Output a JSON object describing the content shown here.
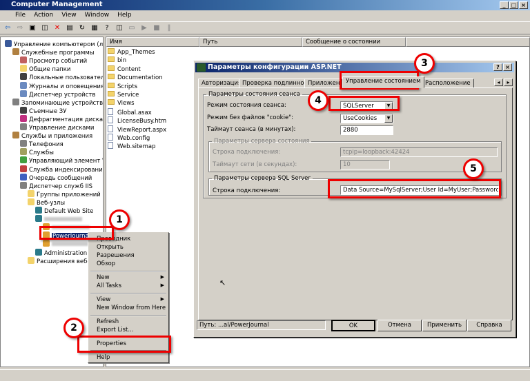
{
  "window": {
    "title": "Computer Management",
    "controls": [
      "_",
      "□",
      "×"
    ]
  },
  "menu": [
    "File",
    "Action",
    "View",
    "Window",
    "Help"
  ],
  "tree": [
    {
      "label": "Управление компьютером (локаль",
      "level": 0,
      "color": "#3a5a9a"
    },
    {
      "label": "Служебные программы",
      "level": 1,
      "color": "#b08040"
    },
    {
      "label": "Просмотр событий",
      "level": 2,
      "color": "#c06060"
    },
    {
      "label": "Общие папки",
      "level": 2,
      "color": "#f3d36b"
    },
    {
      "label": "Локальные пользователи",
      "level": 2,
      "color": "#404040"
    },
    {
      "label": "Журналы и оповещения пр",
      "level": 2,
      "color": "#6a8ac0"
    },
    {
      "label": "Диспетчер устройств",
      "level": 2,
      "color": "#6a8ac0"
    },
    {
      "label": "Запоминающие устройства",
      "level": 1,
      "color": "#808080"
    },
    {
      "label": "Съемные ЗУ",
      "level": 2,
      "color": "#404040"
    },
    {
      "label": "Дефрагментация диска",
      "level": 2,
      "color": "#c03080"
    },
    {
      "label": "Управление дисками",
      "level": 2,
      "color": "#808080"
    },
    {
      "label": "Службы и приложения",
      "level": 1,
      "color": "#b08040"
    },
    {
      "label": "Телефония",
      "level": 2,
      "color": "#808080"
    },
    {
      "label": "Службы",
      "level": 2,
      "color": "#a0a060"
    },
    {
      "label": "Управляющий элемент WM",
      "level": 2,
      "color": "#40a040"
    },
    {
      "label": "Служба индексирования",
      "level": 2,
      "color": "#c04040"
    },
    {
      "label": "Очередь сообщений",
      "level": 2,
      "color": "#4060c0"
    },
    {
      "label": "Диспетчер служб IIS",
      "level": 2,
      "color": "#808080"
    },
    {
      "label": "Группы приложений",
      "level": 3,
      "color": "#f3d36b"
    },
    {
      "label": "Веб-узлы",
      "level": 3,
      "color": "#f3d36b"
    },
    {
      "label": "Default Web Site",
      "level": 4,
      "color": "#2a7a8a"
    },
    {
      "label": "",
      "level": 4,
      "color": "#2a7a8a"
    },
    {
      "label": "",
      "level": 5,
      "color": "#e0a030"
    },
    {
      "label": "PowerJournal",
      "level": 5,
      "color": "#e0a030",
      "selected": true
    },
    {
      "label": "",
      "level": 5,
      "color": "#e0a030"
    },
    {
      "label": "Administration",
      "level": 4,
      "color": "#2a7a8a"
    },
    {
      "label": "Расширения веб-",
      "level": 3,
      "color": "#f3d36b"
    }
  ],
  "list": {
    "columns": [
      "Имя",
      "Путь",
      "Сообщение о состоянии"
    ],
    "items": [
      {
        "name": "App_Themes",
        "type": "folder"
      },
      {
        "name": "bin",
        "type": "folder"
      },
      {
        "name": "Content",
        "type": "folder"
      },
      {
        "name": "Documentation",
        "type": "folder"
      },
      {
        "name": "Scripts",
        "type": "folder"
      },
      {
        "name": "Service",
        "type": "folder"
      },
      {
        "name": "Views",
        "type": "folder"
      },
      {
        "name": "Global.asax",
        "type": "file"
      },
      {
        "name": "LicenseBusy.htm",
        "type": "file"
      },
      {
        "name": "ViewReport.aspx",
        "type": "file"
      },
      {
        "name": "Web.config",
        "type": "file"
      },
      {
        "name": "Web.sitemap",
        "type": "file"
      }
    ]
  },
  "dialog": {
    "title": "Параметры конфигурации ASP.NET",
    "icon_text": "ASP NET",
    "tabs": [
      "Авторизация",
      "Проверка подлинности",
      "Приложение",
      "Управление состоянием",
      "Расположение"
    ],
    "active_tab": "Управление состоянием",
    "session": {
      "legend": "Параметры состояния сеанса",
      "mode_label": "Режим состояния сеанса:",
      "mode_value": "SQLServer",
      "cookieless_label": "Режим без файлов \"cookie\":",
      "cookieless_value": "UseCookies",
      "timeout_label": "Таймаут сеанса (в минутах):",
      "timeout_value": "2880"
    },
    "state_server": {
      "legend": "Параметры сервера состояния",
      "conn_label": "Строка подключения:",
      "conn_value": "tcpip=loopback:42424",
      "timeout_label": "Таймаут сети (в секундах):",
      "timeout_value": "10"
    },
    "sql_server": {
      "legend": "Параметры сервера SQL Server",
      "conn_label": "Строка подключения:",
      "conn_value": "Data Source=MySqlServer;User Id=MyUser;Password=MyPass"
    },
    "path": "Путь: ...al/PowerJournal",
    "buttons": {
      "ok": "OK",
      "cancel": "Отмена",
      "apply": "Применить",
      "help": "Справка"
    }
  },
  "context_menu": {
    "items": [
      "Проводник",
      "Открыть",
      "Разрешения",
      "Обзор",
      "New",
      "All Tasks",
      "View",
      "New Window from Here",
      "Refresh",
      "Export List...",
      "Properties",
      "Help"
    ]
  },
  "annotations": [
    "1",
    "2",
    "3",
    "4",
    "5"
  ],
  "colors": {
    "annotation": "#ee0000",
    "selection": "#0a246a",
    "title_start": "#0a246a"
  }
}
